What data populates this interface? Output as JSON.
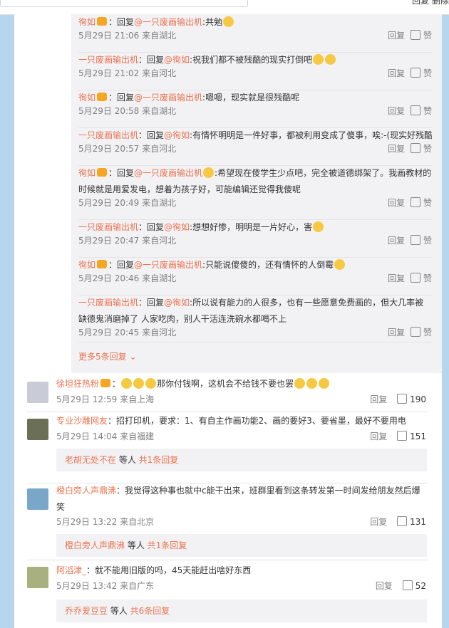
{
  "topbar": {
    "right_text": "回复  删除"
  },
  "replies": [
    {
      "name": "徇如",
      "at": "@一只废画输出机",
      "text": ":共勉",
      "meta": "5月29日 21:06 来自湖北"
    },
    {
      "name": "一只废画输出机",
      "at": "@徇如",
      "text": ":祝我们都不被残酷的现实打倒吧",
      "meta": "5月29日 21:02 来自河北"
    },
    {
      "name": "徇如",
      "at": "@一只废画输出机",
      "text": ":嗯嗯，现实就是很残酷呢",
      "meta": "5月29日 20:58 来自湖北"
    },
    {
      "name": "一只废画输出机",
      "at": "@徇如",
      "text": ":有情怀明明是一件好事，都被利用变成了傻事，唉:-(现实好残酷",
      "meta": "5月29日 20:57 来自河北"
    },
    {
      "name": "徇如",
      "at": "@一只废画输出机",
      "text": ":希望现在傻学生少点吧，完全被道德绑架了。我画教材的时候就是用爱发电，想着为孩子好，可能编辑还觉得我傻呢",
      "meta": "5月29日 20:49 来自湖北"
    },
    {
      "name": "一只废画输出机",
      "at": "@徇如",
      "text": ":想想好惨，明明是一片好心，害",
      "meta": "5月29日 20:47 来自河北"
    },
    {
      "name": "徇如",
      "at": "@一只废画输出机",
      "text": ":只能说傻傻的，还有情怀的人倒霉",
      "meta": "5月29日 20:46 来自湖北"
    },
    {
      "name": "一只废画输出机",
      "at": "@徇如",
      "text": ":所以说有能力的人很多，也有一些愿意免费画的，但大几率被缺德鬼消磨掉了 人家吃肉，别人干活连洗碗水都喝不上",
      "meta": "5月29日 20:45 来自河北"
    }
  ],
  "reply_word": "回复",
  "more_replies": "更多5条回复",
  "comments": [
    {
      "name": "徐坦狂热粉",
      "text": "那你付钱啊，这机会不给钱不要也罢",
      "meta": "5月29日 12:59 来自上海",
      "likes": "190"
    },
    {
      "name": "专业沙雕网友",
      "text": "：招打印机，要求：1、有自主作画功能2、画的要好3、要省墨，最好不要用电",
      "meta": "5月29日 14:04 来自福建",
      "likes": "151",
      "summary": {
        "who": "老胡无处不在",
        "mid": " 等人 ",
        "count": "共1条回复"
      }
    },
    {
      "name": "橙白旁人声鼎沸",
      "text": "：我觉得这种事也就中c能干出来，班群里看到这条转发第一时间发给朋友然后爆笑",
      "meta": "5月29日 13:22 来自北京",
      "likes": "131",
      "summary": {
        "who": "橙白旁人声鼎沸",
        "mid": " 等人 ",
        "count": "共1条回复"
      }
    },
    {
      "name": "阿滔津_",
      "text": "：就不能用旧版的吗，45天能赶出啥好东西",
      "meta": "5月29日 13:42 来自广东",
      "likes": "52",
      "summary": {
        "who": "乔乔爱豆豆",
        "mid": " 等人 ",
        "count": "共6条回复"
      }
    }
  ],
  "colors": {
    "accent": "#eb7350",
    "page_bg": "#b7d6ee",
    "sub_bg": "#f2f2f5"
  }
}
